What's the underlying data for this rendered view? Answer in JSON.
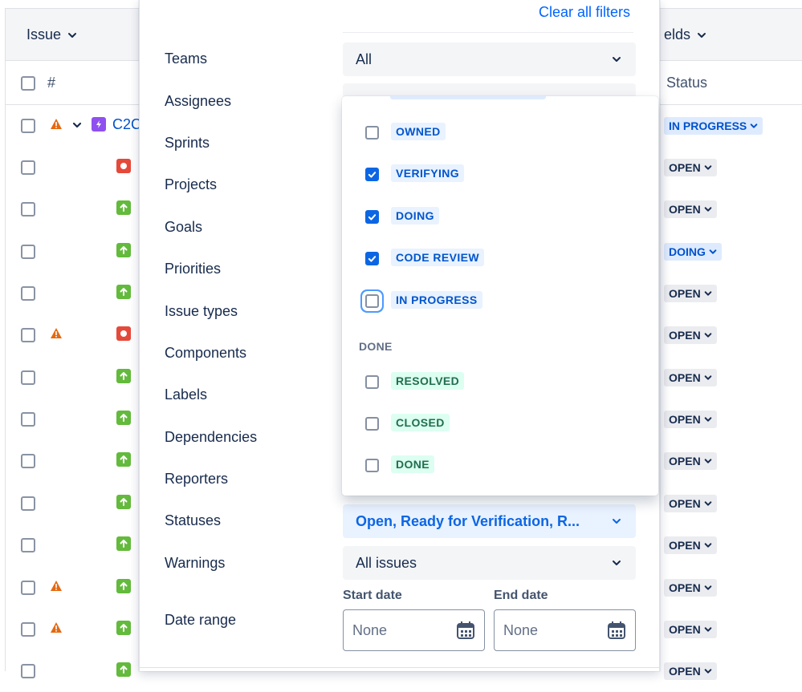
{
  "table": {
    "issue_header": "Issue",
    "fields_header": "elds",
    "hash_header": "#",
    "status_header": "Status",
    "rows": [
      {
        "key": "C2C",
        "status": "IN PROGRESS",
        "status_style": "blue"
      },
      {
        "key": "",
        "status": "OPEN",
        "status_style": "open"
      },
      {
        "key": "",
        "status": "OPEN",
        "status_style": "open"
      },
      {
        "key": "",
        "status": "DOING",
        "status_style": "blue"
      },
      {
        "key": "",
        "status": "OPEN",
        "status_style": "open"
      },
      {
        "key": "",
        "status": "OPEN",
        "status_style": "open"
      },
      {
        "key": "",
        "status": "OPEN",
        "status_style": "open"
      },
      {
        "key": "",
        "status": "OPEN",
        "status_style": "open"
      },
      {
        "key": "",
        "status": "OPEN",
        "status_style": "open"
      },
      {
        "key": "",
        "status": "OPEN",
        "status_style": "open"
      },
      {
        "key": "",
        "status": "OPEN",
        "status_style": "open"
      },
      {
        "key": "",
        "status": "OPEN",
        "status_style": "open"
      },
      {
        "key": "",
        "status": "OPEN",
        "status_style": "open"
      },
      {
        "key": "",
        "status": "OPEN",
        "status_style": "open"
      }
    ]
  },
  "filters": {
    "clear_all": "Clear all filters",
    "labels": {
      "teams": "Teams",
      "assignees": "Assignees",
      "sprints": "Sprints",
      "projects": "Projects",
      "goals": "Goals",
      "priorities": "Priorities",
      "issue_types": "Issue types",
      "components": "Components",
      "labels": "Labels",
      "dependencies": "Dependencies",
      "reporters": "Reporters",
      "statuses": "Statuses",
      "warnings": "Warnings",
      "date_range": "Date range"
    },
    "teams_value": "All",
    "statuses_value": "Open, Ready for Verification, R...",
    "warnings_value": "All issues",
    "start_date_label": "Start date",
    "end_date_label": "End date",
    "start_date_value": "None",
    "end_date_value": "None"
  },
  "status_dropdown": {
    "options": [
      {
        "label": "OWNED",
        "checked": false,
        "color": "blue"
      },
      {
        "label": "VERIFYING",
        "checked": true,
        "color": "blue"
      },
      {
        "label": "DOING",
        "checked": true,
        "color": "blue"
      },
      {
        "label": "CODE REVIEW",
        "checked": true,
        "color": "blue"
      },
      {
        "label": "IN PROGRESS",
        "checked": false,
        "color": "blue",
        "focused": true
      }
    ],
    "done_group_label": "DONE",
    "done_options": [
      {
        "label": "RESOLVED",
        "checked": false,
        "color": "green"
      },
      {
        "label": "CLOSED",
        "checked": false,
        "color": "green"
      },
      {
        "label": "DONE",
        "checked": false,
        "color": "green"
      }
    ]
  },
  "colors": {
    "link_blue": "#0065FF",
    "checked_blue": "#0C66E4",
    "status_blue_bg": "#E9F2FF",
    "status_green_bg": "#DCFFF1"
  }
}
